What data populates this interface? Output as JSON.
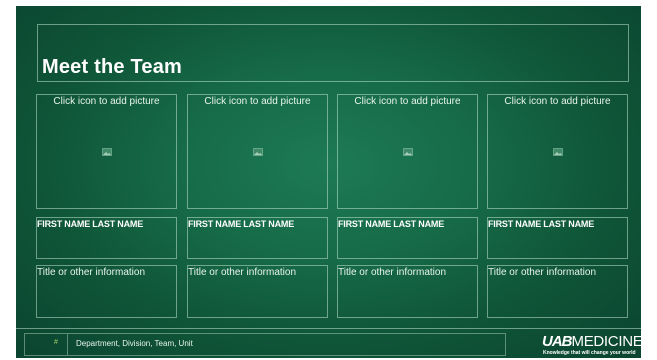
{
  "slide": {
    "title": "Meet the Team",
    "members": [
      {
        "picture_prompt": "Click icon to add picture",
        "name": "FIRST NAME LAST NAME",
        "info": "Title or other information"
      },
      {
        "picture_prompt": "Click icon to add picture",
        "name": "FIRST NAME LAST NAME",
        "info": "Title or other information"
      },
      {
        "picture_prompt": "Click icon to add picture",
        "name": "FIRST NAME LAST NAME",
        "info": "Title or other information"
      },
      {
        "picture_prompt": "Click icon to add picture",
        "name": "FIRST NAME LAST NAME",
        "info": "Title or other information"
      }
    ],
    "footer": {
      "department": "Department, Division, Team, Unit",
      "page_number": "#"
    },
    "logo": {
      "brand_bold": "UAB",
      "brand_text": "MEDICINE",
      "tagline": "Knowledge that will change your world"
    }
  },
  "icons": {
    "picture_placeholder": "picture-placeholder-icon"
  },
  "colors": {
    "background": "#166a47",
    "border": "#bee1cd",
    "text": "#ffffff",
    "page_number": "#9fd16a"
  }
}
